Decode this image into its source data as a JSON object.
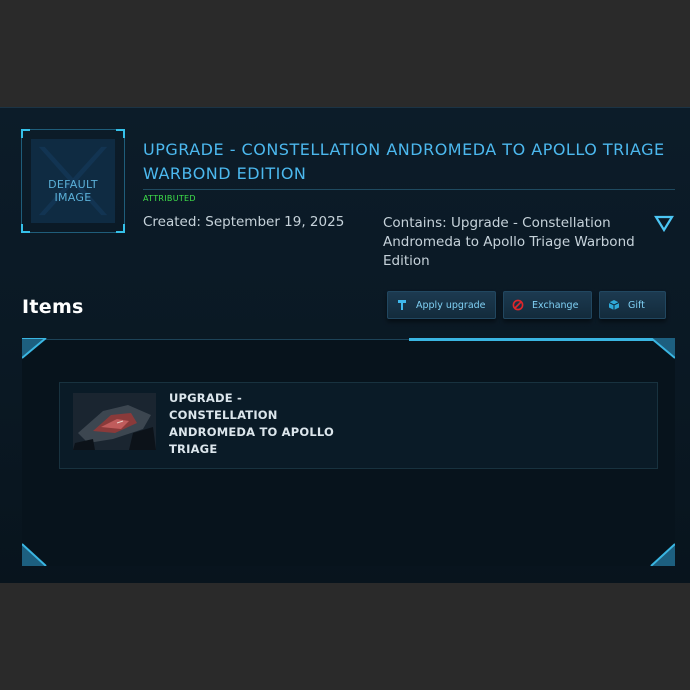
{
  "default_image": {
    "line1": "DEFAULT",
    "line2": "IMAGE"
  },
  "pledge": {
    "title": "UPGRADE - CONSTELLATION ANDROMEDA TO APOLLO TRIAGE WARBOND EDITION",
    "status": "ATTRIBUTED",
    "created": "Created: September 19, 2025",
    "contains": "Contains: Upgrade - Constellation Andromeda to Apollo Triage Warbond Edition"
  },
  "items_section": {
    "heading": "Items",
    "buttons": {
      "apply": "Apply upgrade",
      "exchange": "Exchange",
      "gift": "Gift"
    }
  },
  "items": [
    {
      "name": "UPGRADE - CONSTELLATION ANDROMEDA TO APOLLO TRIAGE"
    }
  ],
  "colors": {
    "accent": "#4cb8ee",
    "status_green": "#3fe04a",
    "exchange_icon": "#e0262b",
    "panel_bg": "#0c1c29"
  },
  "icons": {
    "apply": "upgrade-arrow-icon",
    "exchange": "no-entry-icon",
    "gift": "gift-cube-icon",
    "expand": "chevron-down-icon"
  }
}
